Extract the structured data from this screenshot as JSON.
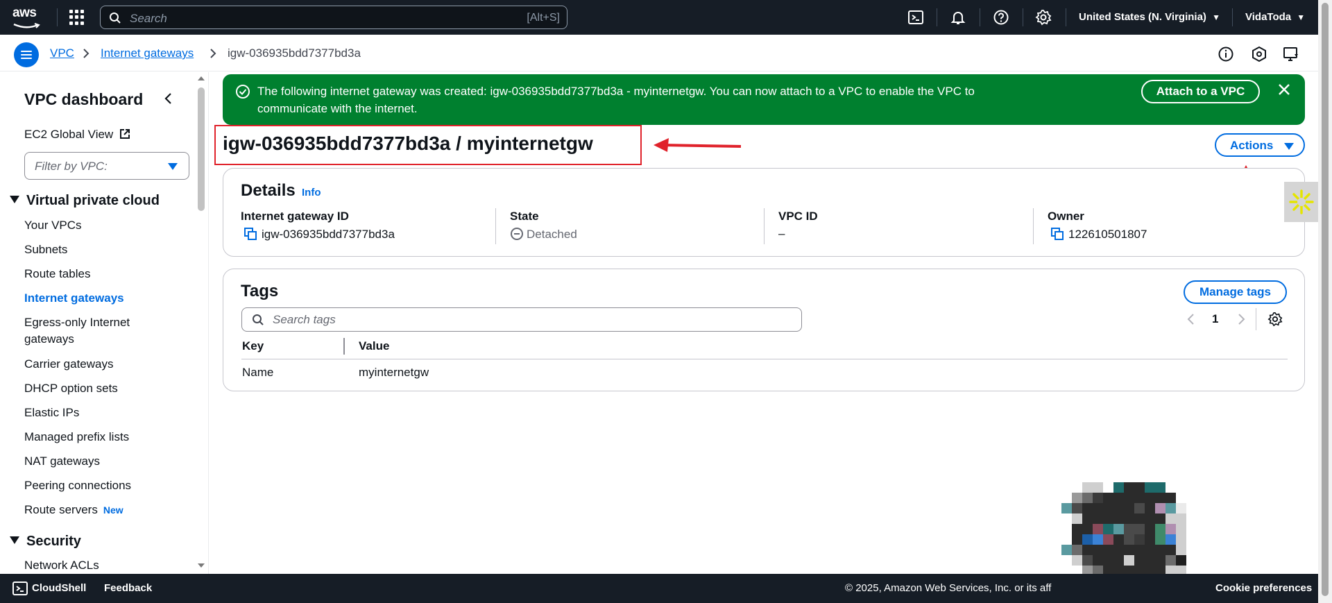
{
  "topnav": {
    "logo_text": "aws",
    "search_placeholder": "Search",
    "search_shortcut": "[Alt+S]",
    "region": "United States (N. Virginia)",
    "user": "VidaToda",
    "icons": [
      "cloudshell-icon",
      "bell-icon",
      "help-icon",
      "gear-icon"
    ]
  },
  "breadcrumb": {
    "items": [
      "VPC",
      "Internet gateways",
      "igw-036935bdd7377bd3a"
    ]
  },
  "sidebar": {
    "title": "VPC dashboard",
    "global_view": "EC2 Global View",
    "filter_placeholder": "Filter by VPC:",
    "section_vpc": "Virtual private cloud",
    "items": [
      "Your VPCs",
      "Subnets",
      "Route tables",
      "Internet gateways",
      "Egress-only Internet",
      "gateways",
      "Carrier gateways",
      "DHCP option sets",
      "Elastic IPs",
      "Managed prefix lists",
      "NAT gateways",
      "Peering connections",
      "Route servers"
    ],
    "new_badge": "New",
    "section_security": "Security",
    "security_items": [
      "Network ACLs"
    ]
  },
  "flash": {
    "message": "The following internet gateway was created: igw-036935bdd7377bd3a - myinternetgw. You can now attach to a VPC to enable the VPC to communicate with the internet.",
    "action_label": "Attach to a VPC",
    "color": "#00802f"
  },
  "page": {
    "title": "igw-036935bdd7377bd3a / myinternetgw",
    "actions_label": "Actions"
  },
  "details": {
    "heading": "Details",
    "info": "Info",
    "fields": [
      {
        "label": "Internet gateway ID",
        "value": "igw-036935bdd7377bd3a"
      },
      {
        "label": "State",
        "value": "Detached"
      },
      {
        "label": "VPC ID",
        "value": "–"
      },
      {
        "label": "Owner",
        "value": "122610501807"
      }
    ]
  },
  "tags": {
    "heading": "Tags",
    "manage_label": "Manage tags",
    "search_placeholder": "Search tags",
    "page_number": "1",
    "columns": [
      "Key",
      "Value"
    ],
    "rows": [
      {
        "key": "Name",
        "value": "myinternetgw"
      }
    ]
  },
  "footer": {
    "cloudshell": "CloudShell",
    "feedback": "Feedback",
    "copyright": "© 2025, Amazon Web Services, Inc. or its aff",
    "cookie": "Cookie preferences"
  },
  "colors": {
    "accent": "#006ce0",
    "nav_bg": "#161d26",
    "success": "#00802f",
    "annotation_red": "#e0222b"
  }
}
